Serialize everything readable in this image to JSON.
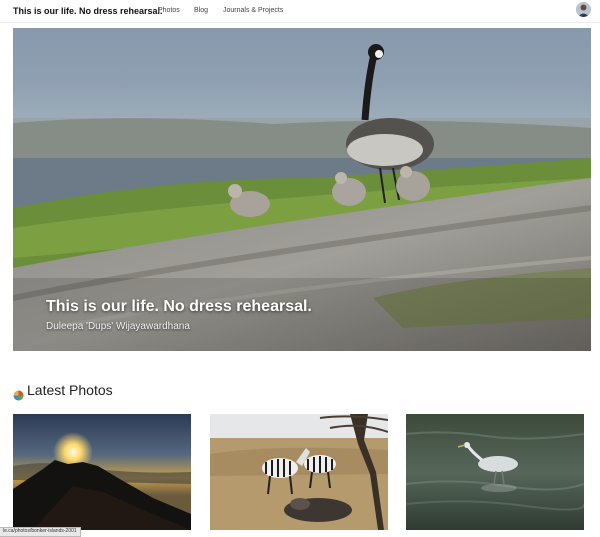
{
  "header": {
    "brand": "This is our life. No dress rehearsal.",
    "nav": [
      {
        "label": "Photos"
      },
      {
        "label": "Blog"
      },
      {
        "label": "Journals & Projects"
      }
    ]
  },
  "hero": {
    "title": "This is our life. No dress rehearsal.",
    "author": "Duleepa 'Dups' Wijayawardhana"
  },
  "latest": {
    "heading": "Latest Photos",
    "photos": [
      {
        "subject": "sunset-over-rocks"
      },
      {
        "subject": "zebras-in-savanna"
      },
      {
        "subject": "heron-in-water"
      }
    ]
  },
  "status_bar": {
    "url": "le.ca/photos/bonker-islands-2001"
  },
  "colors": {
    "background": "#ffffff",
    "nav_text": "#444444",
    "hero_text": "#ffffff"
  }
}
